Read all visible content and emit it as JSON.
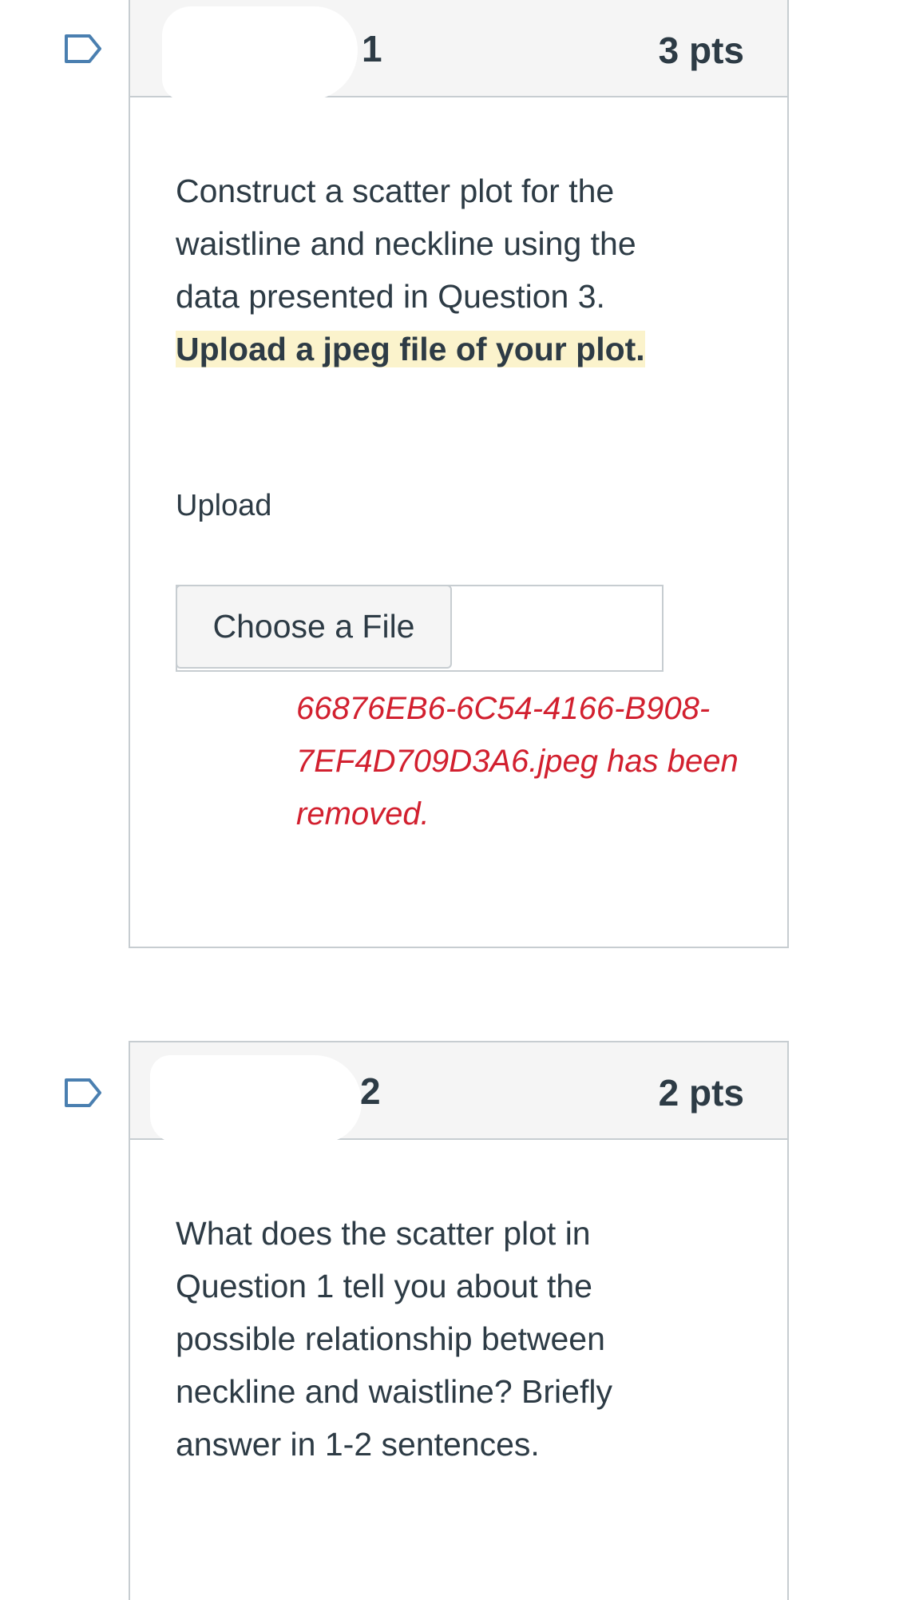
{
  "questions": [
    {
      "number": "1",
      "points": "3 pts",
      "text": "Construct a scatter plot for the waistline and neckline using the data presented in Question 3.",
      "highlighted_text": "Upload a jpeg file of your plot.",
      "upload_label": "Upload",
      "choose_file_label": "Choose a File",
      "removed_message": "66876EB6-6C54-4166-B908-7EF4D709D3A6.jpeg has been removed."
    },
    {
      "number": "2",
      "points": "2 pts",
      "text": "What does the scatter plot in Question 1 tell you about the possible relationship between neckline and waistline? Briefly answer in 1-2 sentences."
    }
  ],
  "colors": {
    "header_bg": "#f5f5f5",
    "border": "#c7cdd1",
    "text": "#2d3b45",
    "highlight": "#fbf3cc",
    "error_red": "#d2202f",
    "flag_blue": "#4a7fb0"
  },
  "icons": {
    "flag": "bookmark-flag-icon"
  }
}
